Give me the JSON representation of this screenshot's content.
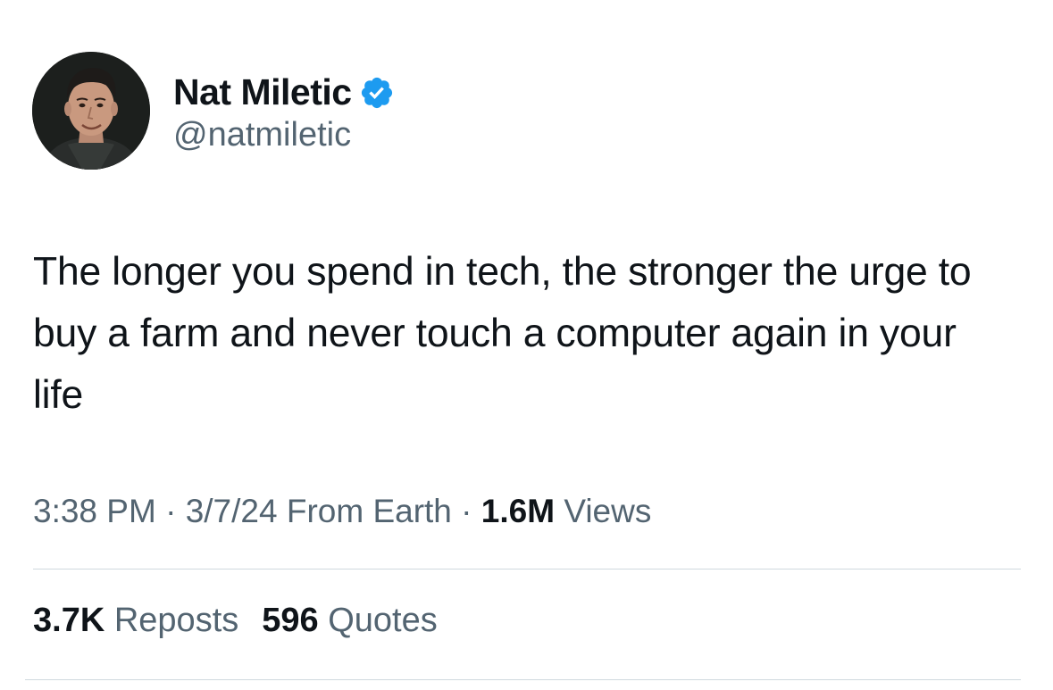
{
  "author": {
    "display_name": "Nat Miletic",
    "handle": "@natmiletic",
    "verified_icon": "verified-badge-icon",
    "verified_color": "#1d9bf0"
  },
  "tweet": {
    "text": "The longer you spend in tech, the stronger the urge to buy a farm and never touch a computer again in your life"
  },
  "meta": {
    "time": "3:38 PM",
    "separator": "·",
    "date": "3/7/24",
    "source": "From Earth",
    "views_count": "1.6M",
    "views_label": "Views"
  },
  "stats": {
    "reposts_count": "3.7K",
    "reposts_label": "Reposts",
    "quotes_count": "596",
    "quotes_label": "Quotes"
  },
  "colors": {
    "text_primary": "#0f1419",
    "text_secondary": "#536471",
    "divider": "#cfd9de"
  }
}
